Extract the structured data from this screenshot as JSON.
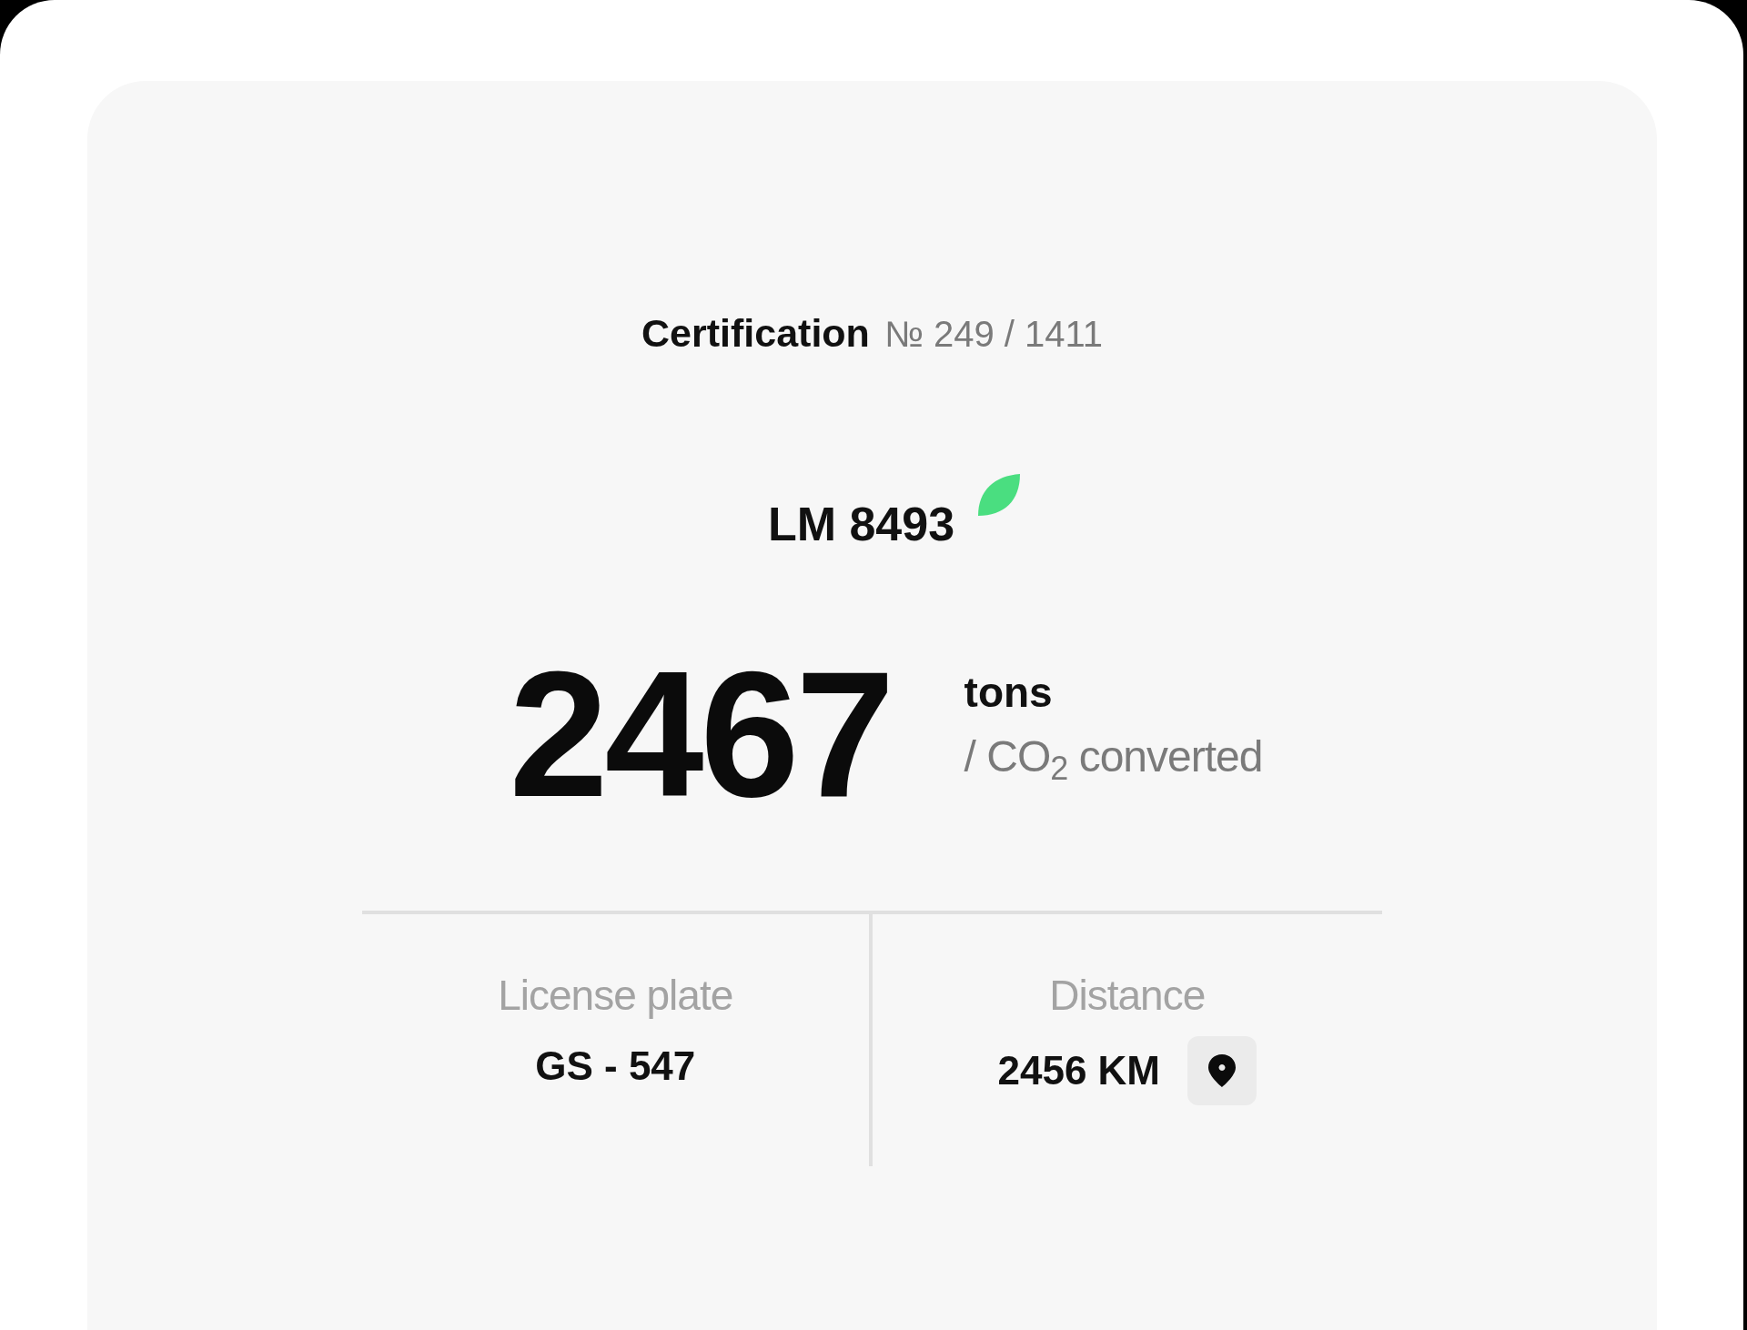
{
  "certificate": {
    "title": "Certification",
    "number": "№ 249 / 1411"
  },
  "vehicle": {
    "code": "LM 8493",
    "eco": true
  },
  "amount": {
    "value": "2467",
    "unit": "tons",
    "caption": "/ CO$_{2}$ converted"
  },
  "details": [
    {
      "label": "License plate",
      "value": "GS - 547",
      "kind": "text"
    },
    {
      "label": "Distance",
      "value": "2456 KM",
      "kind": "location"
    }
  ]
}
